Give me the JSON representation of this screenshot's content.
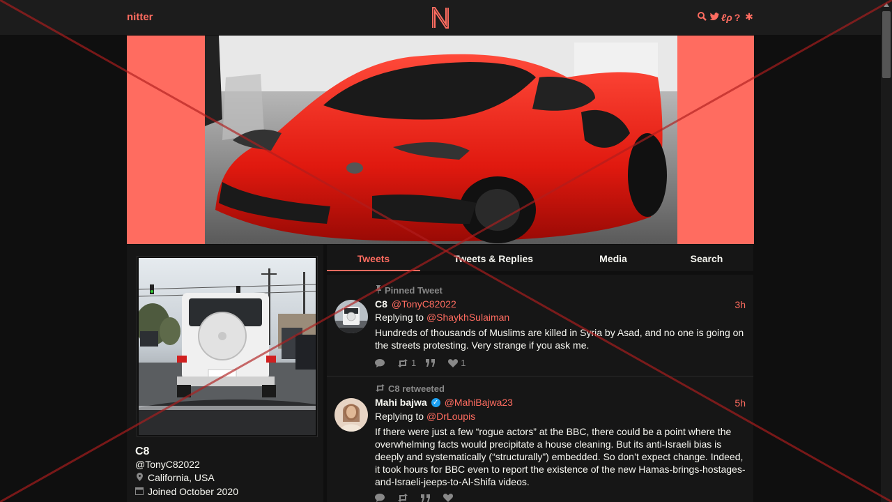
{
  "nav": {
    "brand": "nitter",
    "logo_letter": "N",
    "icons": [
      "search-icon",
      "twitter-icon",
      "rss-icon",
      "help-icon",
      "gear-icon"
    ]
  },
  "profile": {
    "fullname": "C8",
    "username": "@TonyC82022",
    "location": "California, USA",
    "joined": "Joined October 2020"
  },
  "tabs": [
    {
      "label": "Tweets",
      "active": true
    },
    {
      "label": "Tweets & Replies",
      "active": false
    },
    {
      "label": "Media",
      "active": false
    },
    {
      "label": "Search",
      "active": false
    }
  ],
  "tweets": [
    {
      "header": "Pinned Tweet",
      "name": "C8",
      "handle": "@TonyC82022",
      "time": "3h",
      "reply_prefix": "Replying to",
      "reply_to": "@ShaykhSulaiman",
      "body": "Hundreds of thousands of Muslims are killed in Syria by Asad, and no one is going on the streets protesting. Very strange if you ask me.",
      "stats": {
        "comments": "",
        "retweets": "1",
        "quotes": "",
        "likes": "1"
      }
    },
    {
      "header": "C8 retweeted",
      "name": "Mahi bajwa",
      "handle": "@MahiBajwa23",
      "time": "5h",
      "reply_prefix": "Replying to",
      "reply_to": "@DrLoupis",
      "body": "If there were just a few “rogue actors” at the BBC, there could be a point where the overwhelming facts would precipitate a house cleaning. But its anti-Israeli bias is deeply and systematically (“structurally”) embedded. So don’t expect change. Indeed, it took hours for BBC even to report the existence of the new Hamas-brings-hostages-and-Israeli-jeeps-to-Al-Shifa videos.",
      "stats": {
        "comments": "",
        "retweets": "",
        "quotes": "",
        "likes": ""
      }
    }
  ],
  "colors": {
    "accent": "#ff6c60",
    "background": "#0f0f0f",
    "panel": "#161616",
    "nav": "#1c1c1c",
    "text": "#f8f8f2",
    "muted": "#888888",
    "overlay_x": "#b01e1e"
  }
}
